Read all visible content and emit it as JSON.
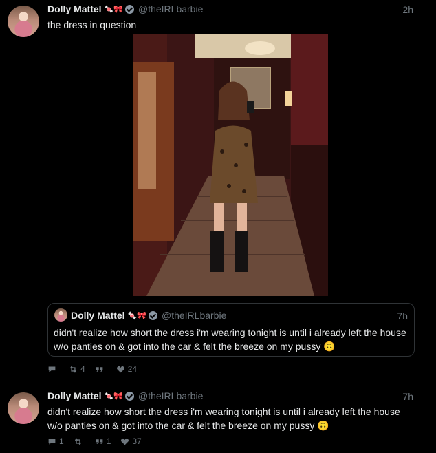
{
  "tweets": [
    {
      "author": {
        "name": "Dolly Mattel",
        "emoji": "🍬🎀",
        "handle": "@theIRLbarbie"
      },
      "time": "2h",
      "text": "the dress in question",
      "photo_icon": "mirror-selfie-photo",
      "quote": {
        "author": {
          "name": "Dolly Mattel",
          "emoji": "🍬🎀",
          "handle": "@theIRLbarbie"
        },
        "time": "7h",
        "text": "didn't realize how short the dress i'm wearing tonight is until i already left the house w/o panties on & got into the car & felt the breeze on my pussy 🙃"
      },
      "actions": {
        "reply": "",
        "retweet": "4",
        "quote": "",
        "like": "24"
      }
    },
    {
      "author": {
        "name": "Dolly Mattel",
        "emoji": "🍬🎀",
        "handle": "@theIRLbarbie"
      },
      "time": "7h",
      "text": "didn't realize how short the dress i'm wearing tonight is until i already left the house w/o panties on & got into the car & felt the breeze on my pussy 🙃",
      "actions": {
        "reply": "1",
        "retweet": "",
        "quote": "1",
        "like": "37"
      }
    }
  ],
  "colors": {
    "background": "#000000",
    "text": "#e7e9ea",
    "muted": "#6e767d",
    "border": "#2f3336"
  }
}
